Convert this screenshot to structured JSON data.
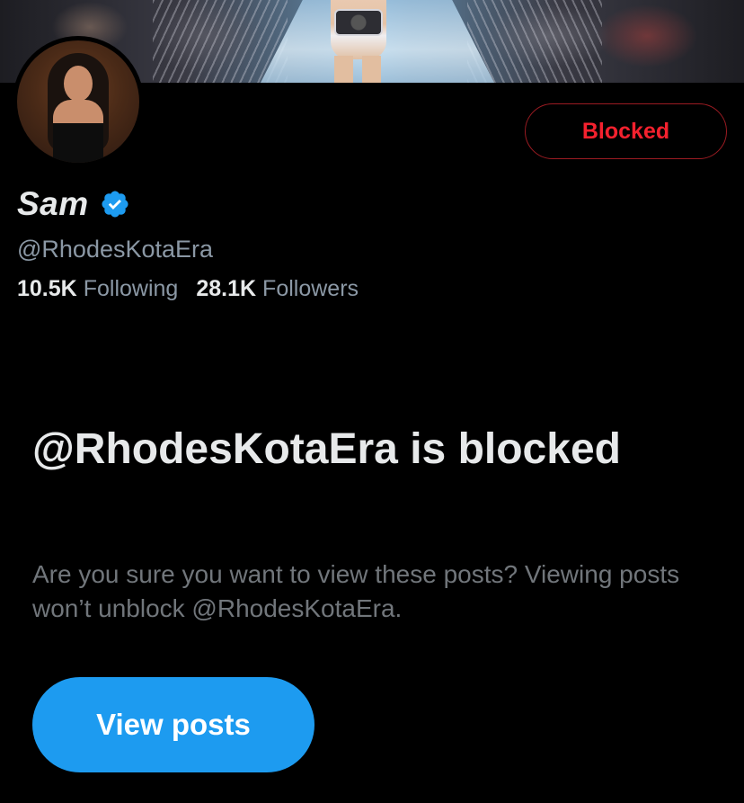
{
  "profile": {
    "display_name": "Sam",
    "verified": true,
    "handle": "@RhodesKotaEra",
    "following_count": "10.5K",
    "following_label": "Following",
    "followers_count": "28.1K",
    "followers_label": "Followers",
    "blocked_button_label": "Blocked"
  },
  "notice": {
    "title": "@RhodesKotaEra is blocked",
    "description": "Are you sure you want to view these posts? Viewing posts won’t unblock @RhodesKotaEra.",
    "view_button_label": "View posts"
  },
  "colors": {
    "background": "#000000",
    "accent_blue": "#1d9bf0",
    "blocked_red": "#f4212e",
    "muted_text": "#71767b"
  },
  "icons": {
    "verified": "verified-badge-icon"
  }
}
